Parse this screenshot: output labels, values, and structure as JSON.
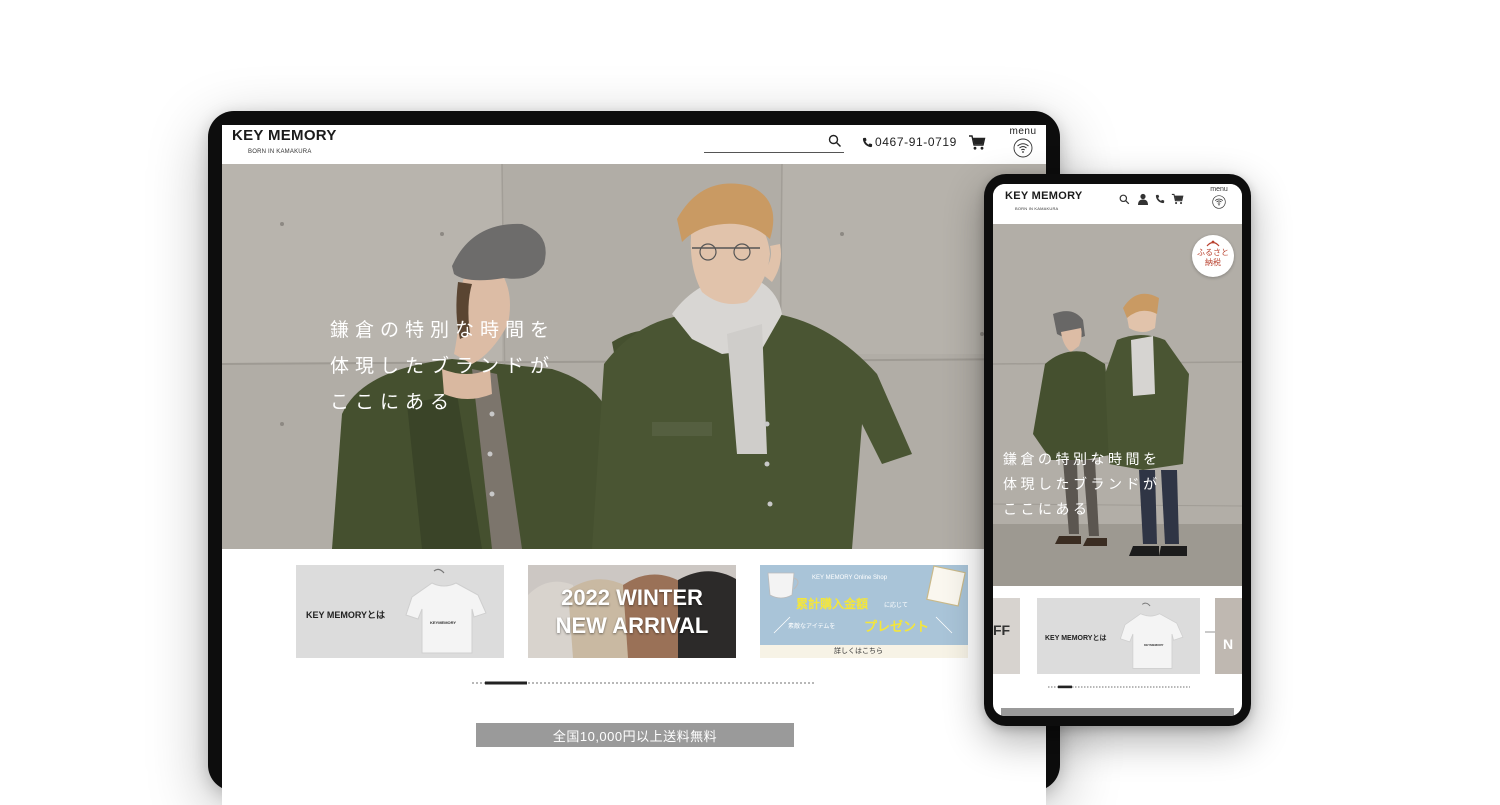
{
  "brand": {
    "name": "KEY MEMORY",
    "tagline": "BORN IN KAMAKURA"
  },
  "header": {
    "phone_number": "0467-91-0719",
    "menu_label": "menu"
  },
  "hero": {
    "copy_lines": [
      "鎌倉の特別な時間を",
      "体現したブランドが",
      "ここにある"
    ]
  },
  "banners": [
    {
      "label": "KEY MEMORYとは",
      "shirt_print": "KEYMEMORY"
    },
    {
      "line1": "2022 WINTER",
      "line2": "NEW ARRIVAL"
    },
    {
      "shop": "KEY MEMORY Online Shop",
      "headline": "累計購入金額",
      "headline_suffix": "に応じて",
      "subline": "素敵なアイテムを",
      "present": "プレゼント",
      "cta": "詳しくはこちら"
    }
  ],
  "free_shipping": "全国10,000円以上送料無料",
  "phone_view": {
    "furusato_line1": "ふるさと",
    "furusato_line2": "納税",
    "prev_banner_partial": "FF",
    "next_banner_partial": "N"
  },
  "colors": {
    "coat_green": "#3f4a2e",
    "furusato_red": "#b8402d",
    "present_yellow": "#f4e63b"
  },
  "icons": [
    "search-icon",
    "phone-icon",
    "cart-icon",
    "wifi-menu-icon",
    "user-icon",
    "arrow-right-icon",
    "furusato-icon"
  ]
}
